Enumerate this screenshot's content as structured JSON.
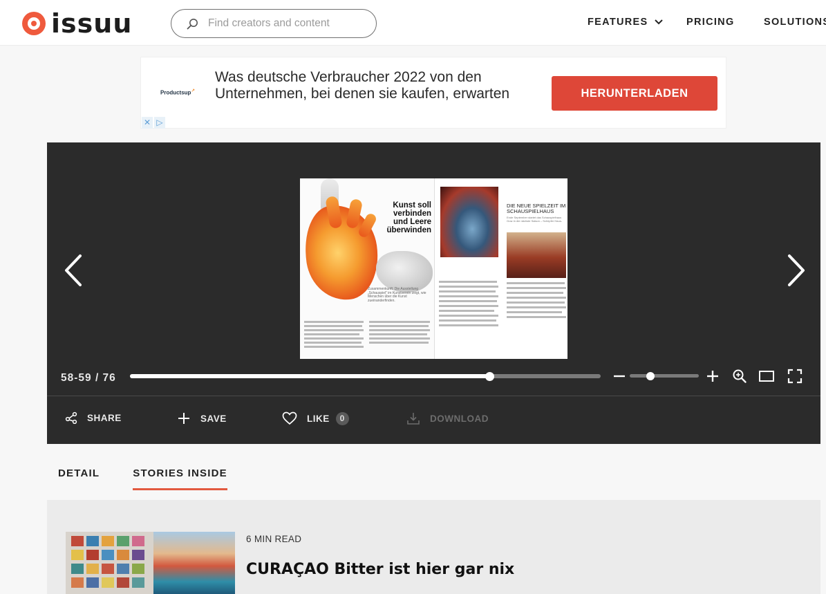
{
  "header": {
    "logo_text": "issuu",
    "search_placeholder": "Find creators and content",
    "nav": [
      "FEATURES",
      "PRICING",
      "SOLUTIONS"
    ]
  },
  "ad": {
    "brand": "Productsup",
    "text": "Was deutsche Verbraucher 2022 von den Unternehmen, bei denen sie kaufen, erwarten",
    "button": "HERUNTERLADEN",
    "choices": [
      "✕",
      "▷"
    ]
  },
  "spread": {
    "left_headline": "Kunst soll verbinden und Leere überwinden",
    "left_blurb": "Zusammenkunft: Die Ausstellung „Schauspiel“ im Kunstverein zeigt, wie Menschen über die Kunst zueinanderfinden.",
    "right_headline": "DIE NEUE SPIELZEIT IM SCHAUSPIELHAUS",
    "right_sub": "Ende September startet das Schauspielhaus Graz in die nächste Saison – Schöpfer Haus-"
  },
  "controls": {
    "page_label": "58-59 / 76",
    "progress_fraction": 0.765,
    "zoom_fraction": 0.3
  },
  "actions": {
    "share": "SHARE",
    "save": "SAVE",
    "like": "LIKE",
    "like_count": "0",
    "download": "DOWNLOAD"
  },
  "tabs": [
    {
      "label": "DETAIL",
      "active": false
    },
    {
      "label": "STORIES INSIDE",
      "active": true
    }
  ],
  "story": {
    "read_time": "6 MIN READ",
    "title": "CURAÇAO Bitter ist hier gar nix"
  },
  "colors": {
    "brand": "#ef5a3d",
    "ad_button": "#de4738",
    "viewer_bg": "#2b2b2b",
    "tab_underline": "#e2593f"
  }
}
